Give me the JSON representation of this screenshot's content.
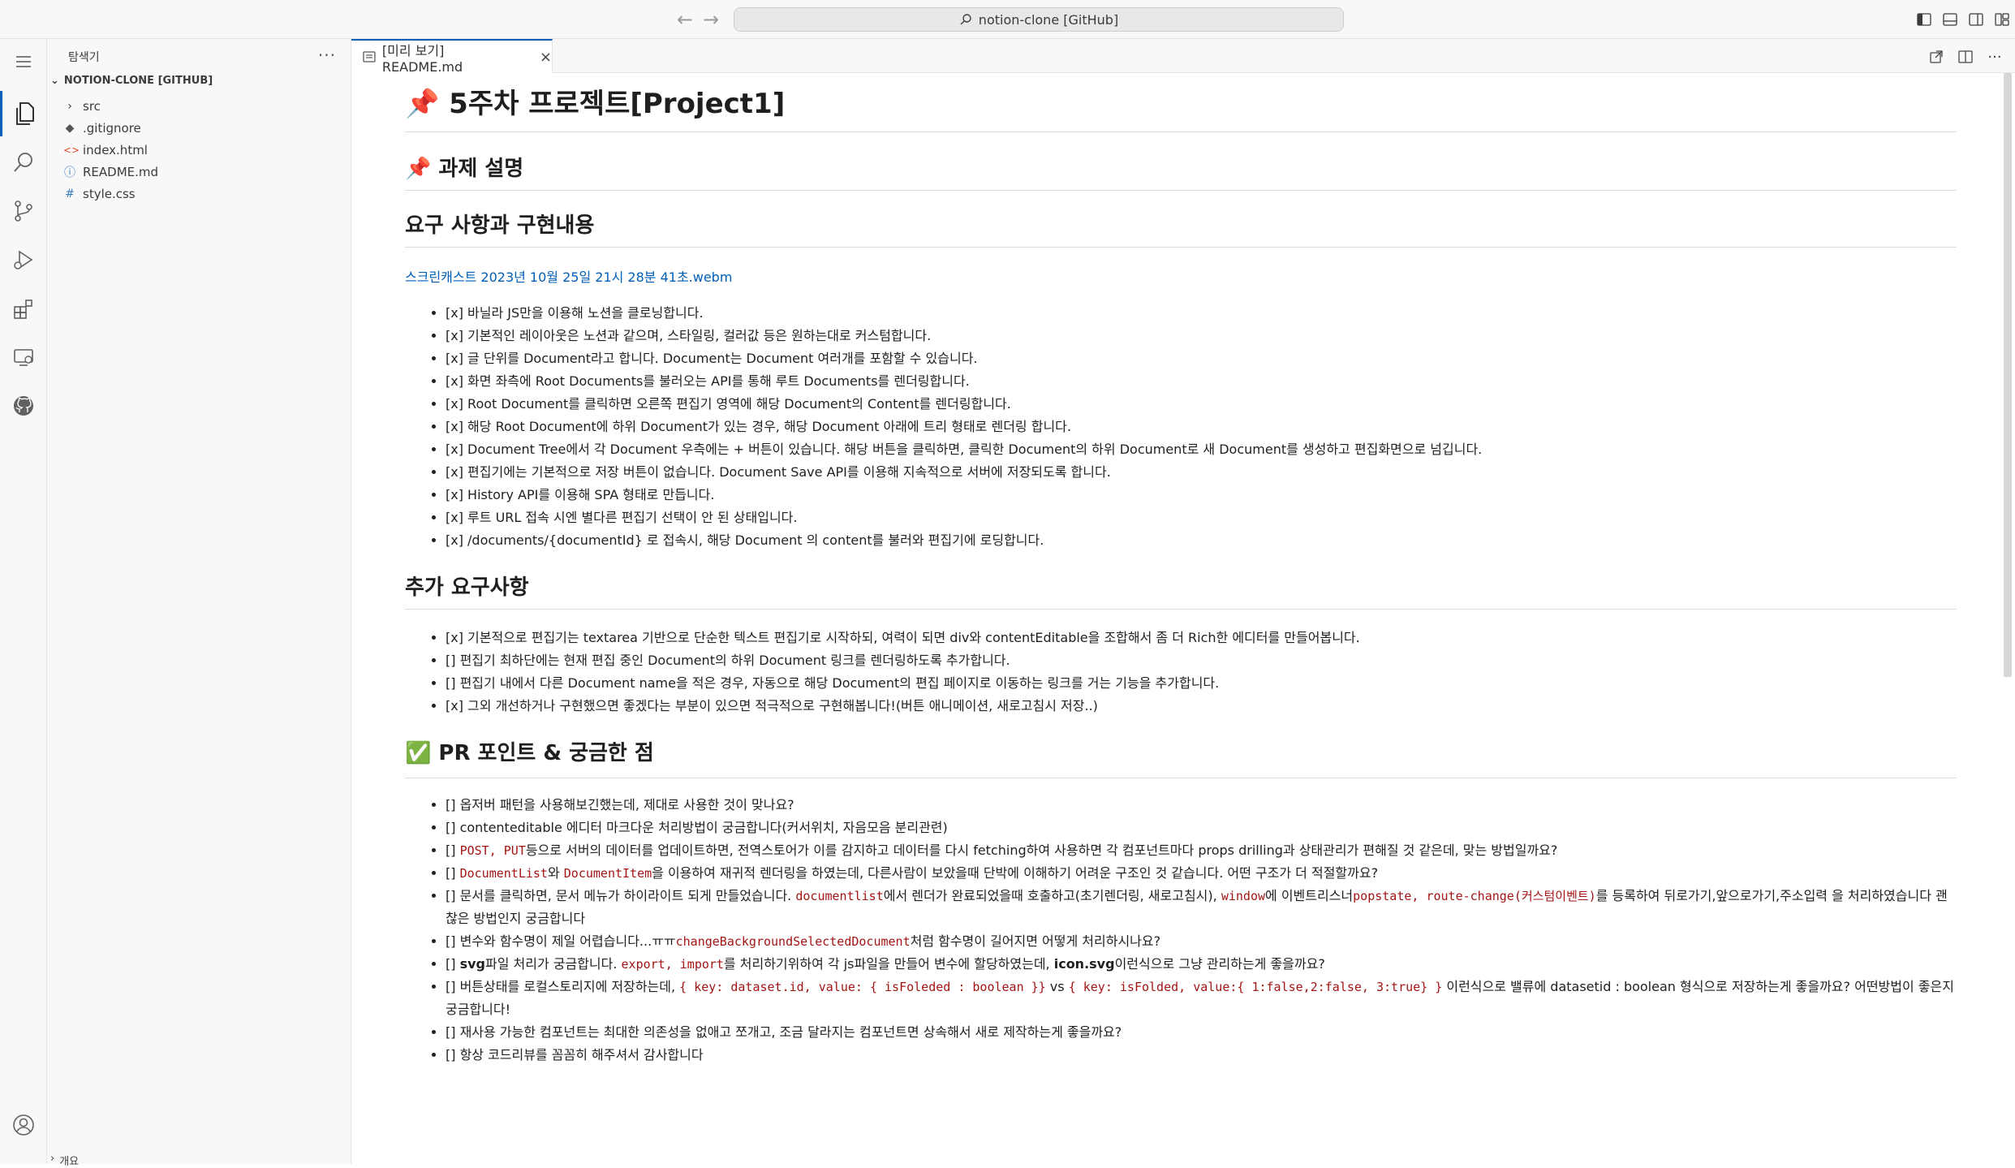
{
  "titlebar": {
    "search_text": "notion-clone [GitHub]"
  },
  "sidebar": {
    "header": "탐색기",
    "more": "···",
    "folder": "NOTION-CLONE [GITHUB]",
    "items": [
      {
        "label": "src",
        "icon": "chevron-right-icon"
      },
      {
        "label": ".gitignore",
        "icon": "git-diamond-icon"
      },
      {
        "label": "index.html",
        "icon": "html-icon"
      },
      {
        "label": "README.md",
        "icon": "info-icon"
      },
      {
        "label": "style.css",
        "icon": "hash-icon"
      }
    ],
    "bottom_section": "개요"
  },
  "tab": {
    "label": "[미리 보기] README.md",
    "close": "×"
  },
  "readme": {
    "h1": "📌 5주차 프로젝트[Project1]",
    "h2_task": "📌 과제 설명",
    "h2_req": "요구 사항과 구현내용",
    "video_link": "스크린캐스트 2023년 10월 25일 21시 28분 41초.webm",
    "requirements": [
      "[x] 바닐라 JS만을 이용해 노션을 클로닝합니다.",
      "[x] 기본적인 레이아웃은 노션과 같으며, 스타일링, 컬러값 등은 원하는대로 커스텀합니다.",
      "[x] 글 단위를 Document라고 합니다. Document는 Document 여러개를 포함할 수 있습니다.",
      "[x] 화면 좌측에 Root Documents를 불러오는 API를 통해 루트 Documents를 렌더링합니다.",
      "[x] Root Document를 클릭하면 오른쪽 편집기 영역에 해당 Document의 Content를 렌더링합니다.",
      "[x] 해당 Root Document에 하위 Document가 있는 경우, 해당 Document 아래에 트리 형태로 렌더링 합니다.",
      "[x] Document Tree에서 각 Document 우측에는 + 버튼이 있습니다. 해당 버튼을 클릭하면, 클릭한 Document의 하위 Document로 새 Document를 생성하고 편집화면으로 넘깁니다.",
      "[x] 편집기에는 기본적으로 저장 버튼이 없습니다. Document Save API를 이용해 지속적으로 서버에 저장되도록 합니다.",
      "[x] History API를 이용해 SPA 형태로 만듭니다.",
      "[x] 루트 URL 접속 시엔 별다른 편집기 선택이 안 된 상태입니다.",
      "[x] /documents/{documentId} 로 접속시, 해당 Document 의 content를 불러와 편집기에 로딩합니다."
    ],
    "h2_extra": "추가 요구사항",
    "extra": [
      "[x] 기본적으로 편집기는 textarea 기반으로 단순한 텍스트 편집기로 시작하되, 여력이 되면 div와 contentEditable을 조합해서 좀 더 Rich한 에디터를 만들어봅니다.",
      "[] 편집기 최하단에는 현재 편집 중인 Document의 하위 Document 링크를 렌더링하도록 추가합니다.",
      "[] 편집기 내에서 다른 Document name을 적은 경우, 자동으로 해당 Document의 편집 페이지로 이동하는 링크를 거는 기능을 추가합니다.",
      "[x] 그외 개선하거나 구현했으면 좋겠다는 부분이 있으면 적극적으로 구현해봅니다!(버튼 애니메이션, 새로고침시 저장..)"
    ],
    "h2_pr": "✅ PR 포인트 & 궁금한 점",
    "pr": {
      "p1": "[] 옵저버 패턴을 사용해보긴했는데, 제대로 사용한 것이 맞나요?",
      "p2": "[] contenteditable 에디터 마크다운 처리방법이 궁금합니다(커서위치, 자음모음 분리관련)",
      "p3_a": "[] ",
      "p3_code1": "POST, PUT",
      "p3_b": "등으로 서버의 데이터를 업데이트하면, 전역스토어가 이를 감지하고 데이터를 다시 fetching하여 사용하면 각 컴포넌트마다 props drilling과 상태관리가 편해질 것 같은데, 맞는 방법일까요?",
      "p4_a": "[] ",
      "p4_code1": "DocumentList",
      "p4_b": "와 ",
      "p4_code2": "DocumentItem",
      "p4_c": "을 이용하여 재귀적 렌더링을 하였는데, 다른사람이 보았을때 단박에 이해하기 어려운 구조인 것 같습니다. 어떤 구조가 더 적절할까요?",
      "p5_a": "[] 문서를 클릭하면, 문서 메뉴가 하이라이트 되게 만들었습니다. ",
      "p5_code1": "documentlist",
      "p5_b": "에서 렌더가 완료되었을때 호출하고(초기렌더링, 새로고침시), ",
      "p5_code2": "window",
      "p5_c": "에 이벤트리스너",
      "p5_code3": "popstate, route-change(커스텀이벤트)",
      "p5_d": "를 등록하여 뒤로가기,앞으로가기,주소입력 을 처리하였습니다 괜찮은 방법인지 궁금합니다",
      "p6_a": "[] 변수와 함수명이 제일 어렵습니다...ㅠㅠ",
      "p6_code1": "changeBackgroundSelectedDocument",
      "p6_b": "처럼 함수명이 길어지면 어떻게 처리하시나요?",
      "p7_a": "[] ",
      "p7_bold1": "svg",
      "p7_b": "파일 처리가 궁금합니다. ",
      "p7_code1": "export, import",
      "p7_c": "를 처리하기위하여 각 js파일을 만들어 변수에 할당하였는데, ",
      "p7_bold2": "icon.svg",
      "p7_d": "이런식으로 그냥 관리하는게 좋을까요?",
      "p8_a": "[] 버튼상태를 로컬스토리지에 저장하는데, ",
      "p8_code1": "{ key: dataset.id, value: { isFoleded : boolean }}",
      "p8_b": " vs ",
      "p8_code2": "{ key: isFolded, value:{ 1:false,2:false, 3:true} }",
      "p8_c": " 이런식으로 밸류에 datasetid : boolean 형식으로 저장하는게 좋을까요? 어떤방법이 좋은지 궁금합니다!",
      "p9": "[] 재사용 가능한 컴포넌트는 최대한 의존성을 없애고 쪼개고, 조금 달라지는 컴포넌트면 상속해서 새로 제작하는게 좋을까요?",
      "p10": "[] 항상 코드리뷰를 꼼꼼히 해주셔서 감사합니다"
    }
  },
  "colors": {
    "accent": "#005fb8",
    "code": "#a31515",
    "link": "#005fb8"
  }
}
